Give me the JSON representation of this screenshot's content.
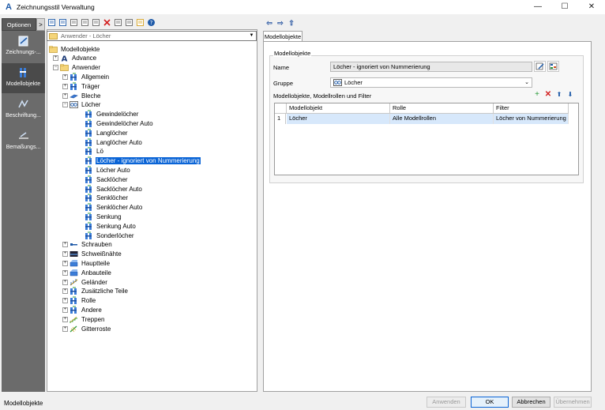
{
  "window": {
    "title": "Zeichnungsstil Verwaltung",
    "app_icon": "A",
    "controls": {
      "minimize": "—",
      "maximize": "☐",
      "close": "✕"
    }
  },
  "left_strip": {
    "options_label": "Optionen",
    "options_arrow": ">",
    "items": [
      {
        "label": "Zeichnungs-...",
        "icon": "drawing-icon"
      },
      {
        "label": "Modellobjekte",
        "icon": "model-objects-icon",
        "active": true
      },
      {
        "label": "Beschriftung...",
        "icon": "label-icon"
      },
      {
        "label": "Bemaßungs...",
        "icon": "dimension-icon"
      }
    ]
  },
  "toolbar": {
    "icons": [
      "new-icon",
      "edit-icon",
      "copy-icon",
      "duplicate-icon",
      "paste-icon",
      "delete-icon",
      "import-icon",
      "export-icon",
      "preview-icon",
      "help-icon"
    ]
  },
  "nav": {
    "back": "⇦",
    "forward": "⇨",
    "up": "⇧"
  },
  "tree_combo": {
    "value": "Anwender - Löcher"
  },
  "tree": [
    {
      "label": "Modellobjekte",
      "depth": 0,
      "icon": "folder",
      "expander": ""
    },
    {
      "label": "Advance",
      "depth": 1,
      "icon": "advance",
      "expander": "+"
    },
    {
      "label": "Anwender",
      "depth": 1,
      "icon": "folder",
      "expander": "−"
    },
    {
      "label": "Allgemein",
      "depth": 2,
      "icon": "model",
      "expander": "+"
    },
    {
      "label": "Träger",
      "depth": 2,
      "icon": "model",
      "expander": "+"
    },
    {
      "label": "Bleche",
      "depth": 2,
      "icon": "plate",
      "expander": "+"
    },
    {
      "label": "Löcher",
      "depth": 2,
      "icon": "group",
      "expander": "−"
    },
    {
      "label": "Gewindelöcher",
      "depth": 3,
      "icon": "model",
      "expander": ""
    },
    {
      "label": "Gewindelöcher Auto",
      "depth": 3,
      "icon": "model",
      "expander": ""
    },
    {
      "label": "Langlöcher",
      "depth": 3,
      "icon": "model",
      "expander": ""
    },
    {
      "label": "Langlöcher Auto",
      "depth": 3,
      "icon": "model",
      "expander": ""
    },
    {
      "label": "Lö",
      "depth": 3,
      "icon": "model",
      "expander": ""
    },
    {
      "label": "Löcher - ignoriert von Nummerierung",
      "depth": 3,
      "icon": "model",
      "expander": "",
      "selected": true
    },
    {
      "label": "Löcher Auto",
      "depth": 3,
      "icon": "model",
      "expander": ""
    },
    {
      "label": "Sacklöcher",
      "depth": 3,
      "icon": "model",
      "expander": ""
    },
    {
      "label": "Sacklöcher Auto",
      "depth": 3,
      "icon": "model",
      "expander": ""
    },
    {
      "label": "Senklöcher",
      "depth": 3,
      "icon": "model",
      "expander": ""
    },
    {
      "label": "Senklöcher Auto",
      "depth": 3,
      "icon": "model",
      "expander": ""
    },
    {
      "label": "Senkung",
      "depth": 3,
      "icon": "model",
      "expander": ""
    },
    {
      "label": "Senkung Auto",
      "depth": 3,
      "icon": "model",
      "expander": ""
    },
    {
      "label": "Sonderlöcher",
      "depth": 3,
      "icon": "model",
      "expander": ""
    },
    {
      "label": "Schrauben",
      "depth": 2,
      "icon": "bolt",
      "expander": "+"
    },
    {
      "label": "Schweißnähte",
      "depth": 2,
      "icon": "weld",
      "expander": "+"
    },
    {
      "label": "Hauptteile",
      "depth": 2,
      "icon": "main",
      "expander": "+"
    },
    {
      "label": "Anbauteile",
      "depth": 2,
      "icon": "main",
      "expander": "+"
    },
    {
      "label": "Geländer",
      "depth": 2,
      "icon": "railing",
      "expander": "+"
    },
    {
      "label": "Zusätzliche Teile",
      "depth": 2,
      "icon": "model",
      "expander": "+"
    },
    {
      "label": "Rolle",
      "depth": 2,
      "icon": "model",
      "expander": "+"
    },
    {
      "label": "Andere",
      "depth": 2,
      "icon": "model",
      "expander": "+"
    },
    {
      "label": "Treppen",
      "depth": 2,
      "icon": "stairs",
      "expander": "+"
    },
    {
      "label": "Gitterroste",
      "depth": 2,
      "icon": "grating",
      "expander": "+"
    }
  ],
  "details": {
    "tab": "Modellobjekte",
    "group_title": "Modellobjekte",
    "name_label": "Name",
    "name_value": "Löcher - ignoriert von Nummerierung",
    "group_label": "Gruppe",
    "group_value": "Löcher",
    "list_label": "Modellobjekte, Modellrollen und Filter",
    "columns": [
      "Modellobjekt",
      "Rolle",
      "Filter"
    ],
    "rows": [
      {
        "num": "1",
        "object": "Löcher",
        "role": "Alle Modellrollen",
        "filter": "Löcher von Nummerierung"
      }
    ]
  },
  "status": {
    "text": "Modellobjekte"
  },
  "buttons": {
    "apply": "Anwenden",
    "ok": "OK",
    "cancel": "Abbrechen",
    "adopt": "Übernehmen"
  },
  "colors": {
    "selection": "#0a64d6",
    "row_highlight": "#d7e8fb",
    "strip": "#6b6b6b"
  }
}
